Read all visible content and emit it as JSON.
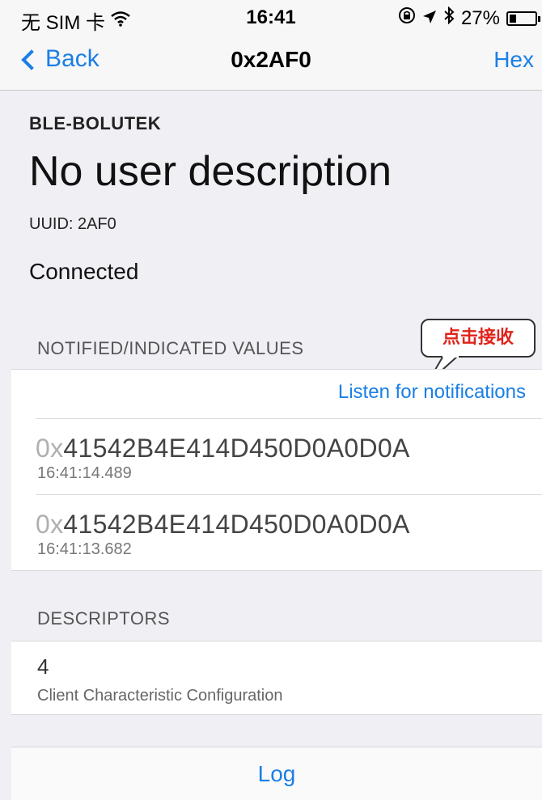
{
  "status_bar": {
    "carrier": "无 SIM 卡",
    "wifi_icon": "wifi-icon",
    "time": "16:41",
    "battery_percent": "27%",
    "battery_level": 0.27
  },
  "nav": {
    "back_label": "Back",
    "title": "0x2AF0",
    "right_label": "Hex"
  },
  "info": {
    "device_name": "BLE-BOLUTEK",
    "description": "No user description",
    "uuid": "UUID: 2AF0",
    "connection_status": "Connected"
  },
  "notified": {
    "header": "NOTIFIED/INDICATED VALUES",
    "listen_label": "Listen for notifications",
    "values": [
      {
        "prefix": "0x",
        "value": "41542B4E414D450D0A0D0A",
        "timestamp": "16:41:14.489"
      },
      {
        "prefix": "0x",
        "value": "41542B4E414D450D0A0D0A",
        "timestamp": "16:41:13.682"
      }
    ]
  },
  "descriptors": {
    "header": "DESCRIPTORS",
    "items": [
      {
        "number": "4",
        "label": "Client Characteristic Configuration"
      }
    ]
  },
  "footer": {
    "log_label": "Log"
  },
  "annotation": {
    "callout_text": "点击接收"
  }
}
